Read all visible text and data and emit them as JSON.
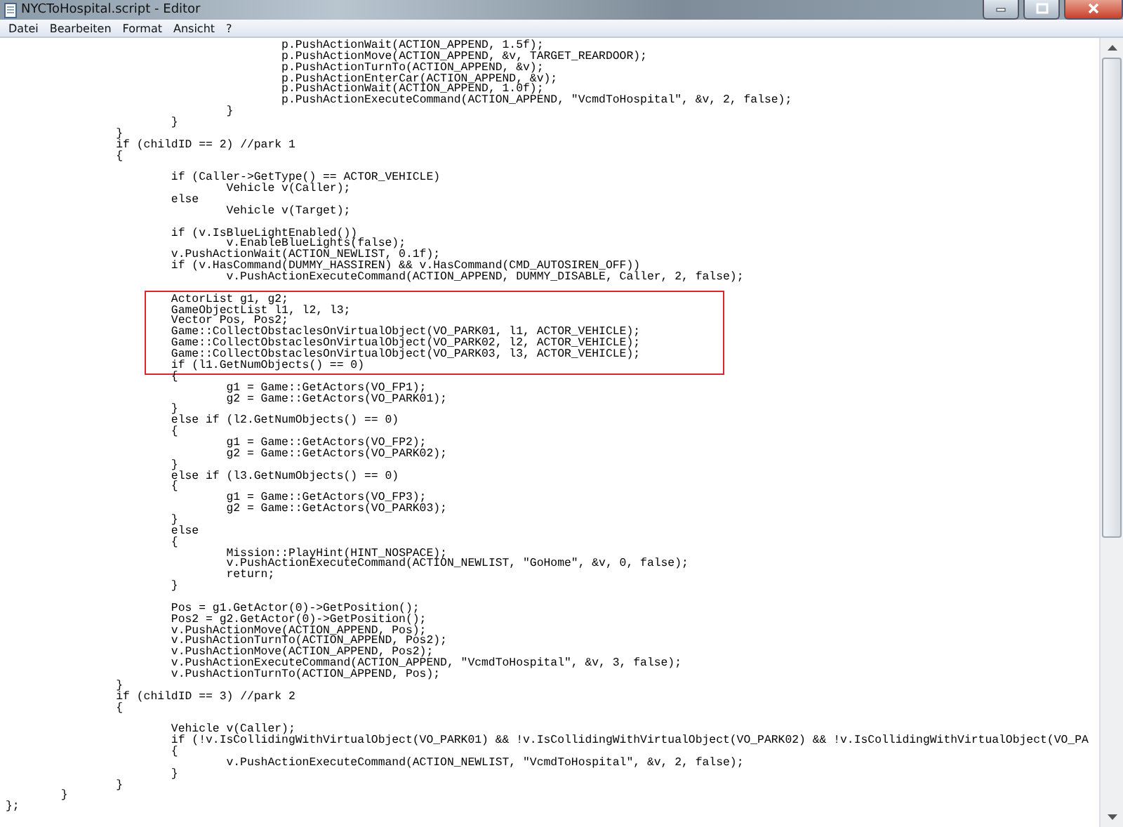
{
  "window": {
    "title": "NYCToHospital.script - Editor"
  },
  "menu": [
    "Datei",
    "Bearbeiten",
    "Format",
    "Ansicht",
    "?"
  ],
  "editor": {
    "segments": [
      {
        "gap_before": false,
        "highlighted": false,
        "lines": [
          "\t\t\t\t\tp.PushActionWait(ACTION_APPEND, 1.5f);",
          "\t\t\t\t\tp.PushActionMove(ACTION_APPEND, &v, TARGET_REARDOOR);",
          "\t\t\t\t\tp.PushActionTurnTo(ACTION_APPEND, &v);",
          "\t\t\t\t\tp.PushActionEnterCar(ACTION_APPEND, &v);",
          "\t\t\t\t\tp.PushActionWait(ACTION_APPEND, 1.0f);",
          "\t\t\t\t\tp.PushActionExecuteCommand(ACTION_APPEND, \"VcmdToHospital\", &v, 2, false);",
          "\t\t\t\t}",
          "\t\t\t}",
          "\t\t}",
          "\t\tif (childID == 2) //park 1",
          "\t\t{"
        ]
      },
      {
        "gap_before": true,
        "highlighted": false,
        "lines": [
          "\t\t\tif (Caller->GetType() == ACTOR_VEHICLE)",
          "\t\t\t\tVehicle v(Caller);",
          "\t\t\telse",
          "\t\t\t\tVehicle v(Target);"
        ]
      },
      {
        "gap_before": true,
        "highlighted": false,
        "lines": [
          "\t\t\tif (v.IsBlueLightEnabled())",
          "\t\t\t\tv.EnableBlueLights(false);",
          "\t\t\tv.PushActionWait(ACTION_NEWLIST, 0.1f);",
          "\t\t\tif (v.HasCommand(DUMMY_HASSIREN) && v.HasCommand(CMD_AUTOSIREN_OFF))",
          "\t\t\t\tv.PushActionExecuteCommand(ACTION_APPEND, DUMMY_DISABLE, Caller, 2, false);"
        ]
      },
      {
        "gap_before": true,
        "highlighted": true,
        "lines": [
          "\t\t\tActorList g1, g2;",
          "\t\t\tGameObjectList l1, l2, l3;",
          "\t\t\tVector Pos, Pos2;",
          "\t\t\tGame::CollectObstaclesOnVirtualObject(VO_PARK01, l1, ACTOR_VEHICLE);",
          "\t\t\tGame::CollectObstaclesOnVirtualObject(VO_PARK02, l2, ACTOR_VEHICLE);",
          "\t\t\tGame::CollectObstaclesOnVirtualObject(VO_PARK03, l3, ACTOR_VEHICLE);",
          "\t\t\tif (l1.GetNumObjects() == 0)"
        ]
      },
      {
        "gap_before": false,
        "highlighted": false,
        "lines": [
          "\t\t\t{",
          "\t\t\t\tg1 = Game::GetActors(VO_FP1);",
          "\t\t\t\tg2 = Game::GetActors(VO_PARK01);",
          "\t\t\t}",
          "\t\t\telse if (l2.GetNumObjects() == 0)",
          "\t\t\t{",
          "\t\t\t\tg1 = Game::GetActors(VO_FP2);",
          "\t\t\t\tg2 = Game::GetActors(VO_PARK02);",
          "\t\t\t}",
          "\t\t\telse if (l3.GetNumObjects() == 0)",
          "\t\t\t{",
          "\t\t\t\tg1 = Game::GetActors(VO_FP3);",
          "\t\t\t\tg2 = Game::GetActors(VO_PARK03);",
          "\t\t\t}",
          "\t\t\telse",
          "\t\t\t{",
          "\t\t\t\tMission::PlayHint(HINT_NOSPACE);",
          "\t\t\t\tv.PushActionExecuteCommand(ACTION_NEWLIST, \"GoHome\", &v, 0, false);",
          "\t\t\t\treturn;",
          "\t\t\t}"
        ]
      },
      {
        "gap_before": true,
        "highlighted": false,
        "lines": [
          "\t\t\tPos = g1.GetActor(0)->GetPosition();",
          "\t\t\tPos2 = g2.GetActor(0)->GetPosition();",
          "\t\t\tv.PushActionMove(ACTION_APPEND, Pos);",
          "\t\t\tv.PushActionTurnTo(ACTION_APPEND, Pos2);",
          "\t\t\tv.PushActionMove(ACTION_APPEND, Pos2);",
          "\t\t\tv.PushActionExecuteCommand(ACTION_APPEND, \"VcmdToHospital\", &v, 3, false);",
          "\t\t\tv.PushActionTurnTo(ACTION_APPEND, Pos);",
          "\t\t}",
          "\t\tif (childID == 3) //park 2",
          "\t\t{"
        ]
      },
      {
        "gap_before": true,
        "highlighted": false,
        "lines": [
          "\t\t\tVehicle v(Caller);",
          "\t\t\tif (!v.IsCollidingWithVirtualObject(VO_PARK01) && !v.IsCollidingWithVirtualObject(VO_PARK02) && !v.IsCollidingWithVirtualObject(VO_PA",
          "\t\t\t{",
          "\t\t\t\tv.PushActionExecuteCommand(ACTION_NEWLIST, \"VcmdToHospital\", &v, 2, false);",
          "\t\t\t}",
          "\t\t}",
          "\t}",
          "};"
        ]
      }
    ]
  }
}
